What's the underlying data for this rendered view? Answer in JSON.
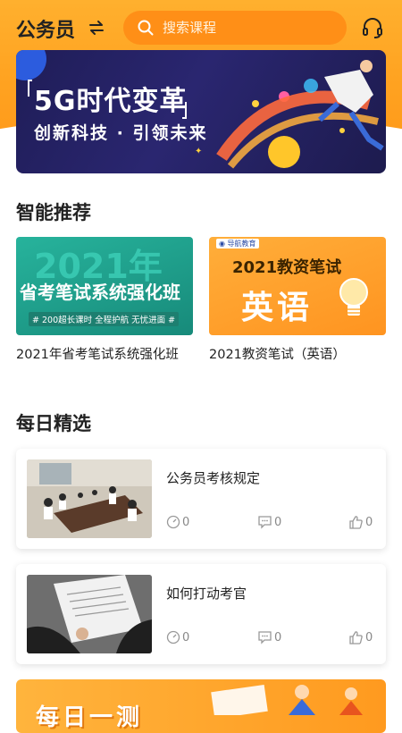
{
  "header": {
    "city": "公务员",
    "search_placeholder": "搜索课程"
  },
  "banner": {
    "title": "5G时代变革",
    "subtitle": "创新科技 · 引领未来"
  },
  "recommend": {
    "title": "智能推荐",
    "items": [
      {
        "caption": "2021年省考笔试系统强化班",
        "thumb_big": "2021年",
        "thumb_main": "省考笔试系统强化班",
        "thumb_tag": "# 200超长课时  全程护航  无忧进面 #"
      },
      {
        "caption": "2021教资笔试（英语）",
        "thumb_logo": "导航教育",
        "thumb_top": "2021教资笔试",
        "thumb_main": "英语"
      }
    ]
  },
  "daily": {
    "title": "每日精选",
    "items": [
      {
        "title": "公务员考核规定",
        "views": "0",
        "comments": "0",
        "likes": "0"
      },
      {
        "title": "如何打动考官",
        "views": "0",
        "comments": "0",
        "likes": "0"
      }
    ]
  },
  "bottom_banner": {
    "text": "每日一测"
  },
  "colors": {
    "accent": "#ffa321",
    "search_bg": "#ff8f17",
    "banner_bg": "#1f1d57",
    "teal": "#1f9e8c"
  }
}
